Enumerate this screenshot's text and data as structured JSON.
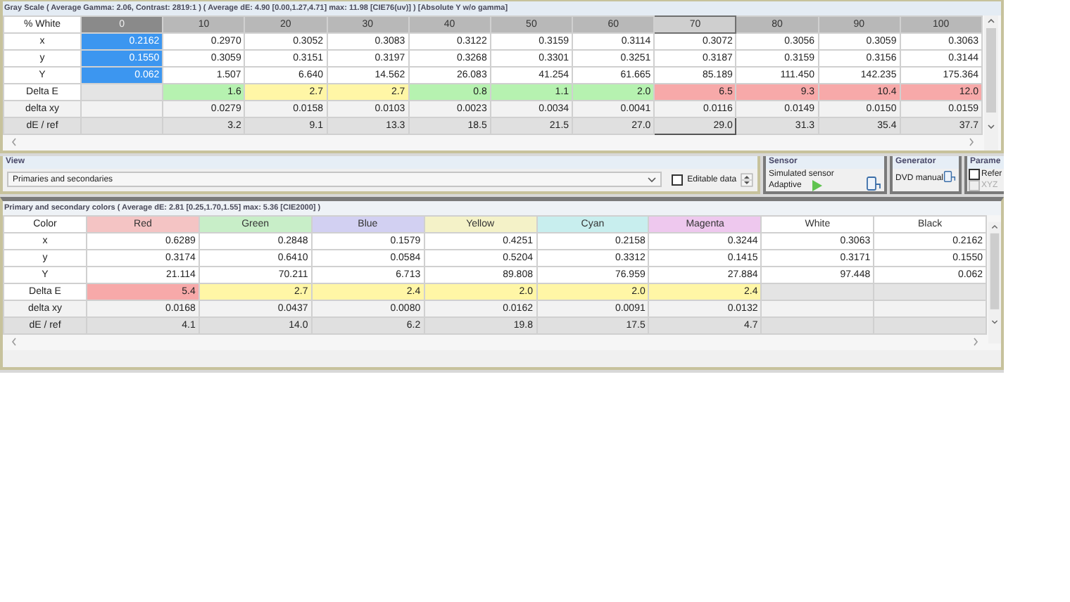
{
  "gray_scale": {
    "title": "Gray Scale ( Average Gamma: 2.06, Contrast: 2819:1 ) ( Average dE: 4.90 [0.00,1.27,4.71] max: 11.98 [CIE76(uv)] ) [Absolute Y w/o gamma]",
    "header_label": "% White",
    "columns": [
      {
        "label": "0",
        "kind": "current"
      },
      {
        "label": "10",
        "kind": "plain"
      },
      {
        "label": "20",
        "kind": "plain"
      },
      {
        "label": "30",
        "kind": "plain"
      },
      {
        "label": "40",
        "kind": "plain"
      },
      {
        "label": "50",
        "kind": "plain"
      },
      {
        "label": "60",
        "kind": "plain"
      },
      {
        "label": "70",
        "kind": "focus"
      },
      {
        "label": "80",
        "kind": "plain"
      },
      {
        "label": "90",
        "kind": "plain"
      },
      {
        "label": "100",
        "kind": "plain"
      }
    ],
    "rows": [
      {
        "label": "x",
        "kind": "value",
        "cells": [
          {
            "text": "0.2162",
            "selected": true
          },
          {
            "text": "0.2970",
            "selected": false
          },
          {
            "text": "0.3052",
            "selected": false
          },
          {
            "text": "0.3083",
            "selected": false
          },
          {
            "text": "0.3122",
            "selected": false
          },
          {
            "text": "0.3159",
            "selected": false
          },
          {
            "text": "0.3114",
            "selected": false
          },
          {
            "text": "0.3072",
            "selected": false
          },
          {
            "text": "0.3056",
            "selected": false
          },
          {
            "text": "0.3059",
            "selected": false
          },
          {
            "text": "0.3063",
            "selected": false
          }
        ]
      },
      {
        "label": "y",
        "kind": "value",
        "cells": [
          {
            "text": "0.1550",
            "selected": true
          },
          {
            "text": "0.3059",
            "selected": false
          },
          {
            "text": "0.3151",
            "selected": false
          },
          {
            "text": "0.3197",
            "selected": false
          },
          {
            "text": "0.3268",
            "selected": false
          },
          {
            "text": "0.3301",
            "selected": false
          },
          {
            "text": "0.3251",
            "selected": false
          },
          {
            "text": "0.3187",
            "selected": false
          },
          {
            "text": "0.3159",
            "selected": false
          },
          {
            "text": "0.3156",
            "selected": false
          },
          {
            "text": "0.3144",
            "selected": false
          }
        ]
      },
      {
        "label": "Y",
        "kind": "value",
        "cells": [
          {
            "text": "0.062",
            "selected": true
          },
          {
            "text": "1.507",
            "selected": false
          },
          {
            "text": "6.640",
            "selected": false
          },
          {
            "text": "14.562",
            "selected": false
          },
          {
            "text": "26.083",
            "selected": false
          },
          {
            "text": "41.254",
            "selected": false
          },
          {
            "text": "61.665",
            "selected": false
          },
          {
            "text": "85.189",
            "selected": false
          },
          {
            "text": "111.450",
            "selected": false
          },
          {
            "text": "142.235",
            "selected": false
          },
          {
            "text": "175.364",
            "selected": false
          }
        ]
      },
      {
        "label": "Delta E",
        "kind": "delta",
        "cells": [
          {},
          {
            "text": "1.6",
            "color": "#b6f2b0"
          },
          {
            "text": "2.7",
            "color": "#fff6a6"
          },
          {
            "text": "2.7",
            "color": "#fff6a6"
          },
          {
            "text": "0.8",
            "color": "#b6f2b0"
          },
          {
            "text": "1.1",
            "color": "#b6f2b0"
          },
          {
            "text": "2.0",
            "color": "#b6f2b0"
          },
          {
            "text": "6.5",
            "color": "#f7a9a9"
          },
          {
            "text": "9.3",
            "color": "#f7a9a9"
          },
          {
            "text": "10.4",
            "color": "#f7a9a9"
          },
          {
            "text": "12.0",
            "color": "#f7a9a9"
          }
        ]
      },
      {
        "label": "delta xy",
        "kind": "dxy",
        "cells": [
          {},
          {
            "text": "0.0279"
          },
          {
            "text": "0.0158"
          },
          {
            "text": "0.0103"
          },
          {
            "text": "0.0023"
          },
          {
            "text": "0.0034"
          },
          {
            "text": "0.0041"
          },
          {
            "text": "0.0116"
          },
          {
            "text": "0.0149"
          },
          {
            "text": "0.0150"
          },
          {
            "text": "0.0159"
          }
        ]
      },
      {
        "label": "dE / ref",
        "kind": "ref",
        "cells": [
          {
            "focused": false
          },
          {
            "text": "3.2",
            "focused": false
          },
          {
            "text": "9.1",
            "focused": false
          },
          {
            "text": "13.3",
            "focused": false
          },
          {
            "text": "18.5",
            "focused": false
          },
          {
            "text": "21.5",
            "focused": false
          },
          {
            "text": "27.0",
            "focused": false
          },
          {
            "text": "29.0",
            "focused": true
          },
          {
            "text": "31.3",
            "focused": false
          },
          {
            "text": "35.4",
            "focused": false
          },
          {
            "text": "37.7",
            "focused": false
          }
        ]
      }
    ]
  },
  "view": {
    "title": "View",
    "dropdown": {
      "value": "Primaries and secondaries"
    },
    "editable": {
      "label": "Editable data",
      "checked": false
    }
  },
  "sensor": {
    "title": "Sensor",
    "name": "Simulated sensor",
    "mode": "Adaptive"
  },
  "generator": {
    "title": "Generator",
    "name": "DVD manual"
  },
  "parameters": {
    "title": "Parame",
    "options": [
      {
        "label": "Refer",
        "checked": false,
        "disabled": false
      },
      {
        "label": "XYZ",
        "checked": false,
        "disabled": true
      }
    ]
  },
  "colors": {
    "title": "Primary and secondary colors ( Average dE: 2.81 [0.25,1.70,1.55] max: 5.36 [CIE2000] )",
    "header_label": "Color",
    "columns": [
      {
        "label": "Red",
        "color": "#f4c4c4"
      },
      {
        "label": "Green",
        "color": "#c8eec8"
      },
      {
        "label": "Blue",
        "color": "#d2d0f2"
      },
      {
        "label": "Yellow",
        "color": "#f4f2c8"
      },
      {
        "label": "Cyan",
        "color": "#c8eeee"
      },
      {
        "label": "Magenta",
        "color": "#eec8ee"
      },
      {
        "label": "White",
        "color": "#ffffff"
      },
      {
        "label": "Black",
        "color": "#ffffff"
      }
    ],
    "rows": [
      {
        "label": "x",
        "kind": "value",
        "cells": [
          {
            "text": "0.6289"
          },
          {
            "text": "0.2848"
          },
          {
            "text": "0.1579"
          },
          {
            "text": "0.4251"
          },
          {
            "text": "0.2158"
          },
          {
            "text": "0.3244"
          },
          {
            "text": "0.3063"
          },
          {
            "text": "0.2162"
          }
        ]
      },
      {
        "label": "y",
        "kind": "value",
        "cells": [
          {
            "text": "0.3174"
          },
          {
            "text": "0.6410"
          },
          {
            "text": "0.0584"
          },
          {
            "text": "0.5204"
          },
          {
            "text": "0.3312"
          },
          {
            "text": "0.1415"
          },
          {
            "text": "0.3171"
          },
          {
            "text": "0.1550"
          }
        ]
      },
      {
        "label": "Y",
        "kind": "value",
        "cells": [
          {
            "text": "21.114"
          },
          {
            "text": "70.211"
          },
          {
            "text": "6.713"
          },
          {
            "text": "89.808"
          },
          {
            "text": "76.959"
          },
          {
            "text": "27.884"
          },
          {
            "text": "97.448"
          },
          {
            "text": "0.062"
          }
        ]
      },
      {
        "label": "Delta E",
        "kind": "delta",
        "cells": [
          {
            "text": "5.4",
            "color": "#f7a9a9"
          },
          {
            "text": "2.7",
            "color": "#fff6a6"
          },
          {
            "text": "2.4",
            "color": "#fff6a6"
          },
          {
            "text": "2.0",
            "color": "#fff6a6"
          },
          {
            "text": "2.0",
            "color": "#fff6a6"
          },
          {
            "text": "2.4",
            "color": "#fff6a6"
          },
          {},
          {}
        ]
      },
      {
        "label": "delta xy",
        "kind": "dxy",
        "cells": [
          {
            "text": "0.0168"
          },
          {
            "text": "0.0437"
          },
          {
            "text": "0.0080"
          },
          {
            "text": "0.0162"
          },
          {
            "text": "0.0091"
          },
          {
            "text": "0.0132"
          },
          {},
          {}
        ]
      },
      {
        "label": "dE / ref",
        "kind": "ref",
        "cells": [
          {
            "text": "4.1"
          },
          {
            "text": "14.0"
          },
          {
            "text": "6.2"
          },
          {
            "text": "19.8"
          },
          {
            "text": "17.5"
          },
          {
            "text": "4.7"
          },
          {},
          {}
        ]
      }
    ]
  }
}
